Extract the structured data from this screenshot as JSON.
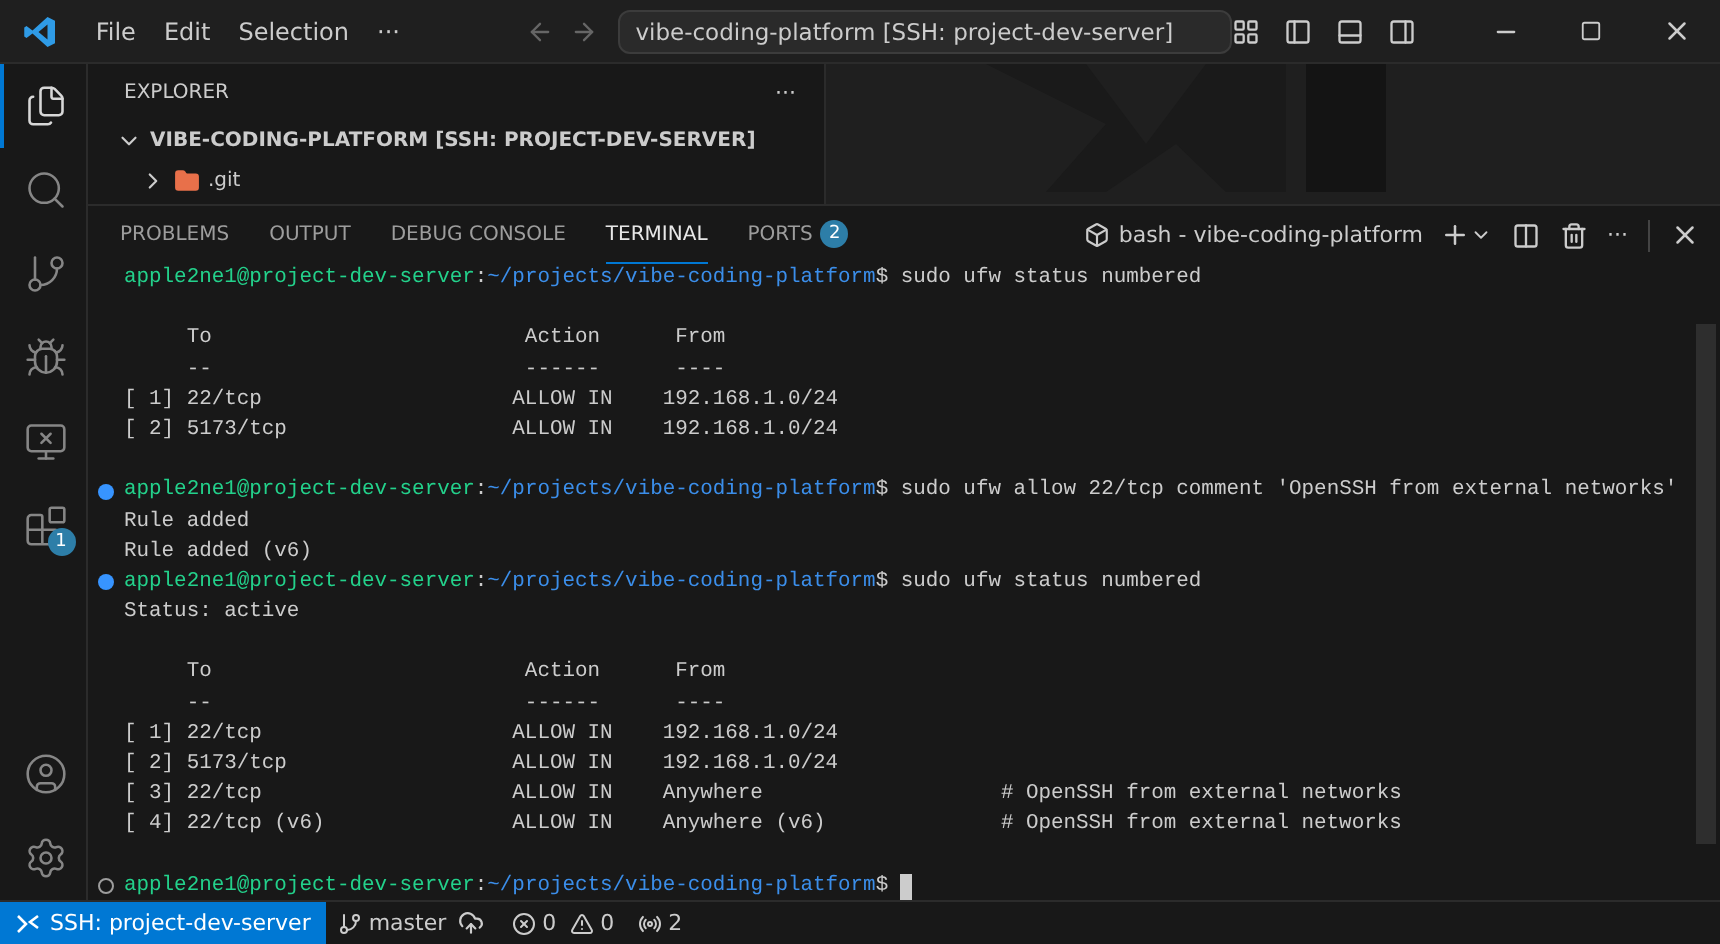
{
  "title_bar": {
    "menu": [
      "File",
      "Edit",
      "Selection",
      "···"
    ],
    "command_center": "vibe-coding-platform [SSH: project-dev-server]"
  },
  "activity_bar": {
    "items": [
      {
        "kind": "explorer",
        "selected": true
      },
      {
        "kind": "search",
        "selected": false
      },
      {
        "kind": "source-control",
        "selected": false
      },
      {
        "kind": "debug",
        "selected": false
      },
      {
        "kind": "remote",
        "selected": false
      },
      {
        "kind": "extensions",
        "selected": false,
        "badge": "1"
      }
    ],
    "bottom": [
      {
        "kind": "account"
      },
      {
        "kind": "settings"
      }
    ]
  },
  "sidebar": {
    "title": "EXPLORER",
    "more": "···",
    "root": {
      "label": "VIBE-CODING-PLATFORM [SSH: PROJECT-DEV-SERVER]",
      "expanded": true,
      "children": [
        {
          "label": ".git",
          "expanded": false
        }
      ]
    }
  },
  "panel": {
    "tabs": [
      {
        "label": "PROBLEMS",
        "selected": false
      },
      {
        "label": "OUTPUT",
        "selected": false
      },
      {
        "label": "DEBUG CONSOLE",
        "selected": false
      },
      {
        "label": "TERMINAL",
        "selected": true
      },
      {
        "label": "PORTS",
        "selected": false,
        "badge": "2"
      }
    ],
    "terminal_name": "bash - vibe-coding-platform",
    "more": "···",
    "lines": [
      {
        "kind": "prompt",
        "decorated": false,
        "user": "apple2ne1@project-dev-server",
        "separator": ":",
        "path": "~/projects/vibe-coding-platform",
        "symbol": "$",
        "command": "sudo ufw status numbered"
      },
      {
        "kind": "blank"
      },
      {
        "kind": "output",
        "text": "     To                         Action      From"
      },
      {
        "kind": "output",
        "text": "     --                         ------      ----"
      },
      {
        "kind": "output",
        "text": "[ 1] 22/tcp                    ALLOW IN    192.168.1.0/24"
      },
      {
        "kind": "output",
        "text": "[ 2] 5173/tcp                  ALLOW IN    192.168.1.0/24"
      },
      {
        "kind": "blank"
      },
      {
        "kind": "prompt",
        "decorated": true,
        "succeeded": true,
        "user": "apple2ne1@project-dev-server",
        "separator": ":",
        "path": "~/projects/vibe-coding-platform",
        "symbol": "$",
        "command": "sudo ufw allow 22/tcp comment 'OpenSSH from external networks'"
      },
      {
        "kind": "output",
        "text": "Rule added"
      },
      {
        "kind": "output",
        "text": "Rule added (v6)"
      },
      {
        "kind": "prompt",
        "decorated": true,
        "succeeded": true,
        "user": "apple2ne1@project-dev-server",
        "separator": ":",
        "path": "~/projects/vibe-coding-platform",
        "symbol": "$",
        "command": "sudo ufw status numbered"
      },
      {
        "kind": "output",
        "text": "Status: active"
      },
      {
        "kind": "blank"
      },
      {
        "kind": "output",
        "text": "     To                         Action      From"
      },
      {
        "kind": "output",
        "text": "     --                         ------      ----"
      },
      {
        "kind": "output",
        "text": "[ 1] 22/tcp                    ALLOW IN    192.168.1.0/24"
      },
      {
        "kind": "output",
        "text": "[ 2] 5173/tcp                  ALLOW IN    192.168.1.0/24"
      },
      {
        "kind": "output",
        "text": "[ 3] 22/tcp                    ALLOW IN    Anywhere                   # OpenSSH from external networks"
      },
      {
        "kind": "output",
        "text": "[ 4] 22/tcp (v6)               ALLOW IN    Anywhere (v6)              # OpenSSH from external networks"
      },
      {
        "kind": "blank"
      },
      {
        "kind": "prompt",
        "decorated": true,
        "succeeded": false,
        "user": "apple2ne1@project-dev-server",
        "separator": ":",
        "path": "~/projects/vibe-coding-platform",
        "symbol": "$",
        "cursor": true
      }
    ]
  },
  "status_bar": {
    "remote": "SSH: project-dev-server",
    "branch": "master",
    "errors": "0",
    "warnings": "0",
    "ports": "2"
  }
}
